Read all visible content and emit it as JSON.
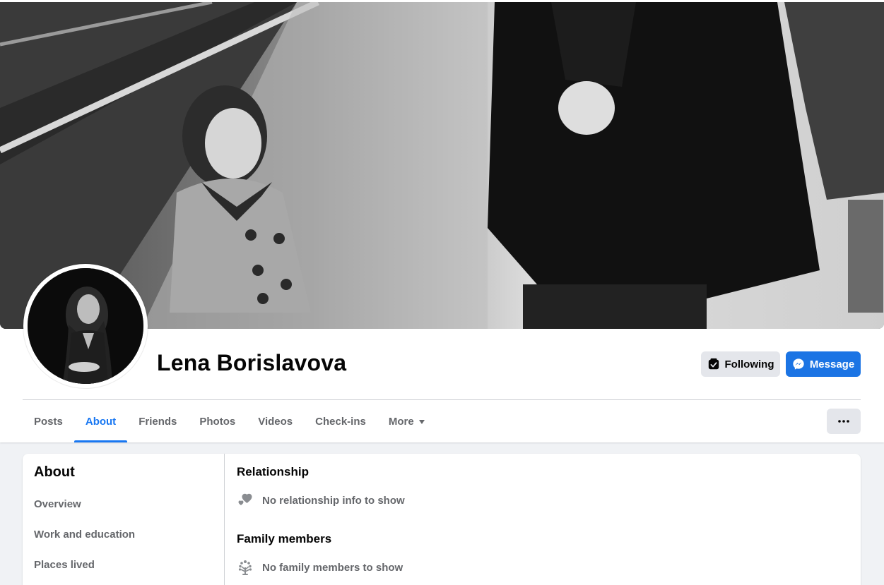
{
  "profile": {
    "name": "Lena Borislavova",
    "following_label": "Following",
    "message_label": "Message"
  },
  "tabs": [
    {
      "label": "Posts",
      "active": false
    },
    {
      "label": "About",
      "active": true
    },
    {
      "label": "Friends",
      "active": false
    },
    {
      "label": "Photos",
      "active": false
    },
    {
      "label": "Videos",
      "active": false
    },
    {
      "label": "Check-ins",
      "active": false
    },
    {
      "label": "More",
      "active": false
    }
  ],
  "about": {
    "title": "About",
    "nav": [
      "Overview",
      "Work and education",
      "Places lived"
    ],
    "sections": [
      {
        "title": "Relationship",
        "icon": "hearts-icon",
        "text": "No relationship info to show"
      },
      {
        "title": "Family members",
        "icon": "family-tree-icon",
        "text": "No family members to show"
      }
    ]
  },
  "colors": {
    "accent": "#1877f2",
    "message_button": "#1b74e4",
    "secondary_button": "#e4e6eb",
    "page_background": "#f0f2f5",
    "muted_text": "#65676b"
  }
}
